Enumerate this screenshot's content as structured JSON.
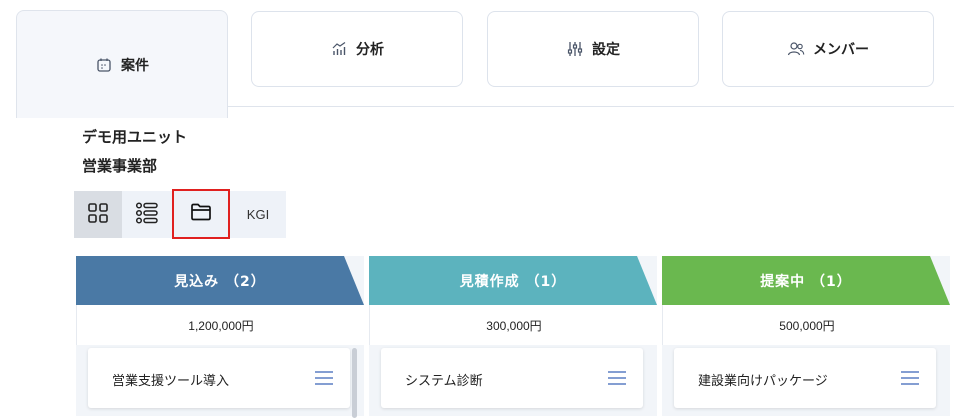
{
  "tabs": [
    {
      "label": "案件",
      "icon": "calendar-icon",
      "active": true
    },
    {
      "label": "分析",
      "icon": "analytics-icon",
      "active": false
    },
    {
      "label": "設定",
      "icon": "sliders-icon",
      "active": false
    },
    {
      "label": "メンバー",
      "icon": "members-icon",
      "active": false
    }
  ],
  "unit": {
    "name": "デモ用ユニット",
    "department": "営業事業部"
  },
  "view_toolbar": {
    "items": [
      {
        "icon": "grid-view-icon",
        "selected": true
      },
      {
        "icon": "list-view-icon",
        "selected": false
      },
      {
        "icon": "folder-icon",
        "selected": false,
        "highlighted": true
      },
      {
        "label": "KGI"
      }
    ]
  },
  "columns": [
    {
      "title": "見込み （2）",
      "color": "#4a79a5",
      "amount": "1,200,000円",
      "card_title": "営業支援ツール導入"
    },
    {
      "title": "見積作成 （1）",
      "color": "#5cb3be",
      "amount": "300,000円",
      "card_title": "システム診断"
    },
    {
      "title": "提案中 （1）",
      "color": "#6ab84f",
      "amount": "500,000円",
      "card_title": "建設業向けパッケージ"
    }
  ],
  "colors": {
    "accent_highlight": "#e0201f",
    "menu_icon": "#5b7fc4"
  }
}
